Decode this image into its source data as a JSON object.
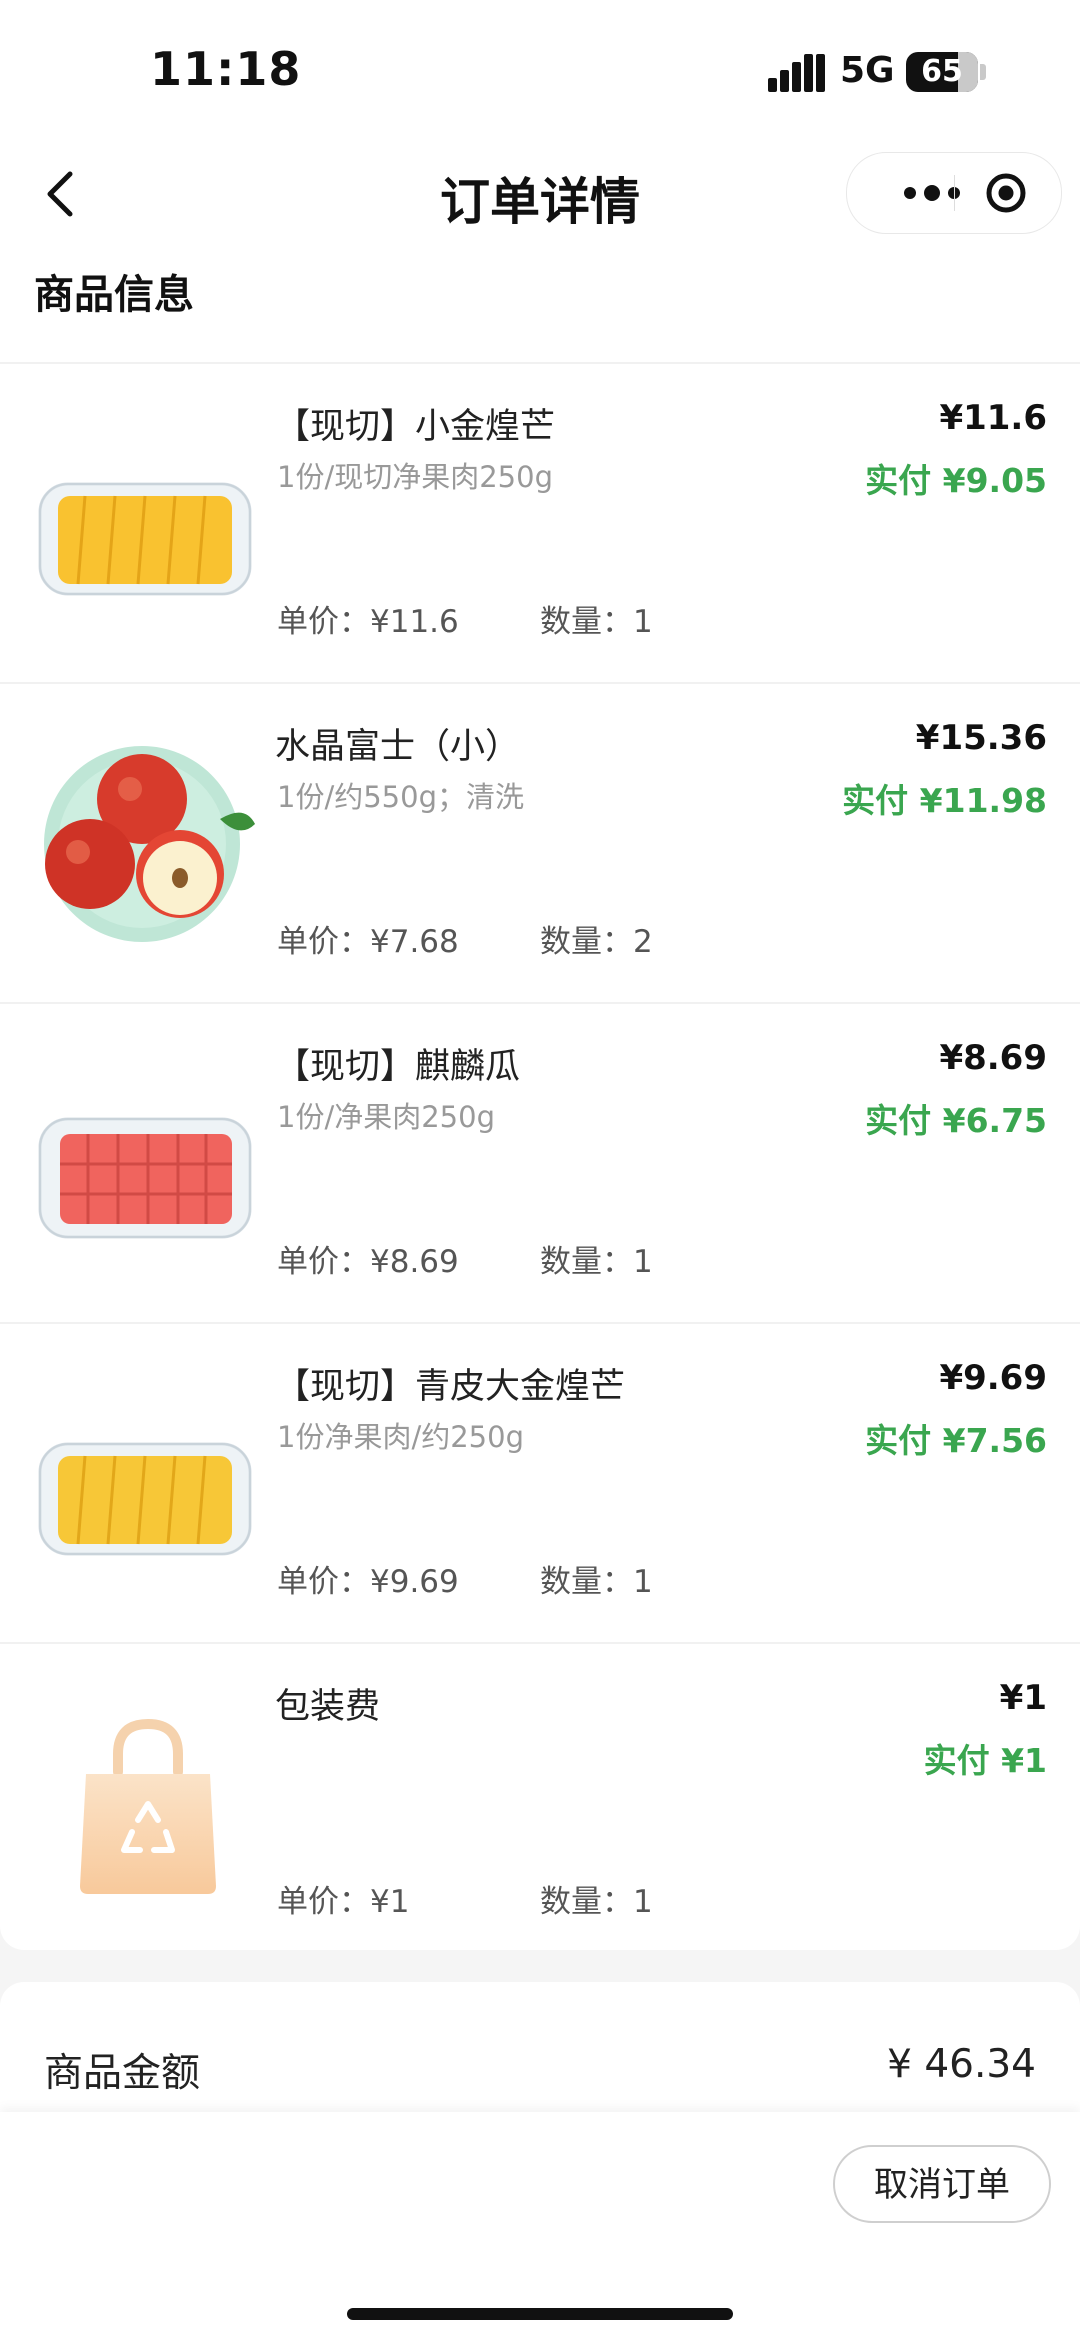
{
  "status_bar": {
    "time": "11:18",
    "network": "5G",
    "battery": "65"
  },
  "nav": {
    "title": "订单详情",
    "menu_icon": "more-dots-icon",
    "close_icon": "target-circle-icon"
  },
  "section_title": "商品信息",
  "items": [
    {
      "name": "【现切】小金煌芒",
      "spec": "1份/现切净果肉250g",
      "price": "¥11.6",
      "paid": "实付 ¥9.05",
      "unit_price": "单价：¥11.6",
      "qty": "数量：1",
      "image": "mango-box"
    },
    {
      "name": "水晶富士（小）",
      "spec": "1份/约550g；清洗",
      "price": "¥15.36",
      "paid": "实付 ¥11.98",
      "unit_price": "单价：¥7.68",
      "qty": "数量：2",
      "image": "apple-plate"
    },
    {
      "name": "【现切】麒麟瓜",
      "spec": "1份/净果肉250g",
      "price": "¥8.69",
      "paid": "实付 ¥6.75",
      "unit_price": "单价：¥8.69",
      "qty": "数量：1",
      "image": "watermelon-box"
    },
    {
      "name": "【现切】青皮大金煌芒",
      "spec": "1份净果肉/约250g",
      "price": "¥9.69",
      "paid": "实付 ¥7.56",
      "unit_price": "单价：¥9.69",
      "qty": "数量：1",
      "image": "mango-box"
    },
    {
      "name": "包装费",
      "spec": "",
      "price": "¥1",
      "paid": "实付 ¥1",
      "unit_price": "单价：¥1",
      "qty": "数量：1",
      "image": "recycle-bag"
    }
  ],
  "summary": {
    "goods_amount_label": "商品金额",
    "goods_amount": "¥ 46.34"
  },
  "actions": {
    "cancel_label": "取消订单"
  },
  "colors": {
    "paid_green": "#3aa64f",
    "page_bg": "#f5f5f5"
  }
}
